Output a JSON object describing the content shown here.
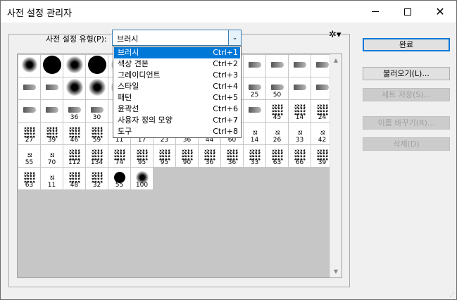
{
  "window": {
    "title": "사전 설정 관리자",
    "close_glyph": "✕"
  },
  "preset_type": {
    "label": "사전 설정 유형(P):",
    "value": "브러시",
    "arrow": "⌄"
  },
  "gear_glyph": "✲▾",
  "dropdown": [
    {
      "label": "브러시",
      "shortcut": "Ctrl+1",
      "selected": true
    },
    {
      "label": "색상 견본",
      "shortcut": "Ctrl+2"
    },
    {
      "label": "그레이디언트",
      "shortcut": "Ctrl+3"
    },
    {
      "label": "스타일",
      "shortcut": "Ctrl+4"
    },
    {
      "label": "패턴",
      "shortcut": "Ctrl+5"
    },
    {
      "label": "윤곽선",
      "shortcut": "Ctrl+6"
    },
    {
      "label": "사용자 정의 모양",
      "shortcut": "Ctrl+7"
    },
    {
      "label": "도구",
      "shortcut": "Ctrl+8"
    }
  ],
  "buttons": {
    "done": "완료",
    "load": "불러오기(L)...",
    "save": "세트 저장(S)...",
    "rename": "이름 바꾸기(R)...",
    "delete": "삭제(D)"
  },
  "brush_rows": [
    [
      {
        "k": "soft",
        "s": 22
      },
      {
        "k": "hard",
        "s": 26
      },
      {
        "k": "soft",
        "s": 24
      },
      {
        "k": "hard",
        "s": 26
      },
      {
        "k": "soft",
        "s": 24
      },
      {
        "k": "hard",
        "s": 26
      },
      {
        "k": "soft",
        "s": 24
      },
      {
        "k": "soft",
        "s": 24
      },
      {
        "k": "soft",
        "s": 24
      },
      {
        "k": "soft",
        "s": 24
      },
      {
        "k": "tool",
        "s": 18
      },
      {
        "k": "tool",
        "s": 18
      },
      {
        "k": "tool",
        "s": 18
      },
      {
        "k": "tool",
        "s": 18
      }
    ],
    [
      {
        "k": "tool",
        "s": 18
      },
      {
        "k": "tool",
        "s": 18
      },
      {
        "k": "soft",
        "s": 24
      },
      {
        "k": "soft",
        "s": 24
      },
      {
        "k": "soft",
        "s": 24
      },
      {
        "k": "soft",
        "s": 24
      },
      {
        "k": "soft",
        "s": 24
      },
      {
        "k": "soft",
        "s": 24
      },
      {
        "k": "soft",
        "s": 24
      },
      {
        "k": "soft",
        "s": 24
      },
      {
        "k": "tool",
        "s": 18,
        "n": "25"
      },
      {
        "k": "tool",
        "s": 18,
        "n": "50"
      },
      {
        "k": "tool",
        "s": 18
      },
      {
        "k": "tool",
        "s": 18
      }
    ],
    [
      {
        "k": "tool",
        "s": 18
      },
      {
        "k": "tool",
        "s": 18
      },
      {
        "k": "tool",
        "s": 18,
        "n": "36"
      },
      {
        "k": "tool",
        "s": 18,
        "n": "30"
      },
      {
        "k": "tool",
        "s": 18
      },
      {
        "k": "tool",
        "s": 18
      },
      {
        "k": "tool",
        "s": 18
      },
      {
        "k": "tool",
        "s": 18
      },
      {
        "k": "tool",
        "s": 18
      },
      {
        "k": "tool",
        "s": 18
      },
      {
        "k": "tool",
        "s": 18
      },
      {
        "k": "sp",
        "s": 16,
        "n": "45"
      },
      {
        "k": "sp",
        "s": 16,
        "n": "14"
      },
      {
        "k": "sp",
        "s": 16,
        "n": "24"
      }
    ],
    [
      {
        "k": "sp",
        "s": 16,
        "n": "27"
      },
      {
        "k": "sp",
        "s": 16,
        "n": "39"
      },
      {
        "k": "sp",
        "s": 16,
        "n": "46"
      },
      {
        "k": "sp",
        "s": 16,
        "n": "59"
      },
      {
        "k": "sp",
        "s": 16,
        "n": "11"
      },
      {
        "k": "sp",
        "s": 16,
        "n": "17"
      },
      {
        "k": "sp",
        "s": 16,
        "n": "23"
      },
      {
        "k": "sp",
        "s": 16,
        "n": "36"
      },
      {
        "k": "sp",
        "s": 16,
        "n": "44"
      },
      {
        "k": "sp",
        "s": 16,
        "n": "60"
      },
      {
        "k": "sp",
        "s": 6,
        "n": "14"
      },
      {
        "k": "sp",
        "s": 6,
        "n": "26"
      },
      {
        "k": "sp",
        "s": 6,
        "n": "33"
      },
      {
        "k": "sp",
        "s": 6,
        "n": "42"
      }
    ],
    [
      {
        "k": "sp",
        "s": 6,
        "n": "55"
      },
      {
        "k": "sp",
        "s": 6,
        "n": "70"
      },
      {
        "k": "sp",
        "s": 16,
        "n": "112"
      },
      {
        "k": "sp",
        "s": 16,
        "n": "134"
      },
      {
        "k": "sp",
        "s": 16,
        "n": "74"
      },
      {
        "k": "sp",
        "s": 16,
        "n": "95"
      },
      {
        "k": "sp",
        "s": 16,
        "n": "95"
      },
      {
        "k": "sp",
        "s": 16,
        "n": "90"
      },
      {
        "k": "sp",
        "s": 16,
        "n": "36"
      },
      {
        "k": "sp",
        "s": 16,
        "n": "36"
      },
      {
        "k": "sp",
        "s": 16,
        "n": "33"
      },
      {
        "k": "sp",
        "s": 16,
        "n": "63"
      },
      {
        "k": "sp",
        "s": 16,
        "n": "66"
      },
      {
        "k": "sp",
        "s": 16,
        "n": "39"
      }
    ],
    [
      {
        "k": "sp",
        "s": 16,
        "n": "63"
      },
      {
        "k": "sp",
        "s": 6,
        "n": "11"
      },
      {
        "k": "sp",
        "s": 16,
        "n": "48"
      },
      {
        "k": "sp",
        "s": 16,
        "n": "32"
      },
      {
        "k": "hard",
        "s": 16,
        "n": "55"
      },
      {
        "k": "soft",
        "s": 18,
        "n": "100"
      }
    ]
  ]
}
